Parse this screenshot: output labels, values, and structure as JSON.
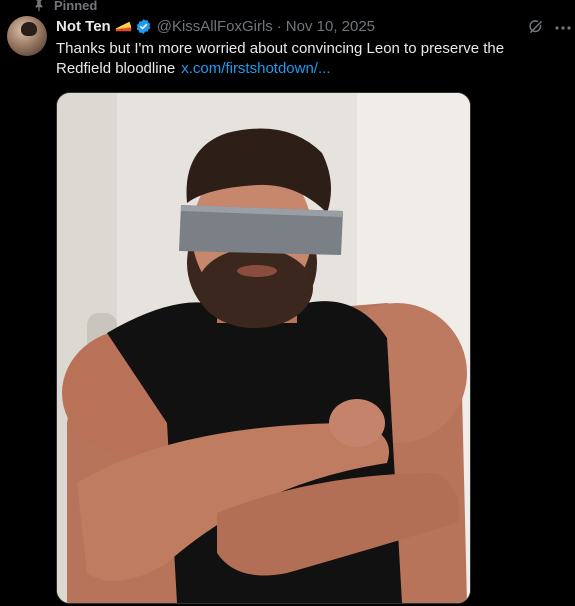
{
  "pinned": {
    "label": "Pinned",
    "icon": "pin-icon"
  },
  "author": {
    "display_name": "Not Ten",
    "emoji": "cheese-wedge-emoji",
    "verified": true,
    "verified_color": "#1d9bf0",
    "handle": "@KissAllFoxGirls",
    "separator": "·",
    "date": "Nov 10, 2025"
  },
  "tweet": {
    "text": "Thanks but I'm more worried about convincing Leon to preserve the Redfield bloodline",
    "link_text": "x.com/firstshotdown/..."
  },
  "actions": {
    "grok_icon": "grok-icon",
    "more_icon": "more-options-icon"
  },
  "colors": {
    "background": "#000000",
    "text": "#e7e9ea",
    "muted": "#71767b",
    "link": "#1d9bf0"
  }
}
